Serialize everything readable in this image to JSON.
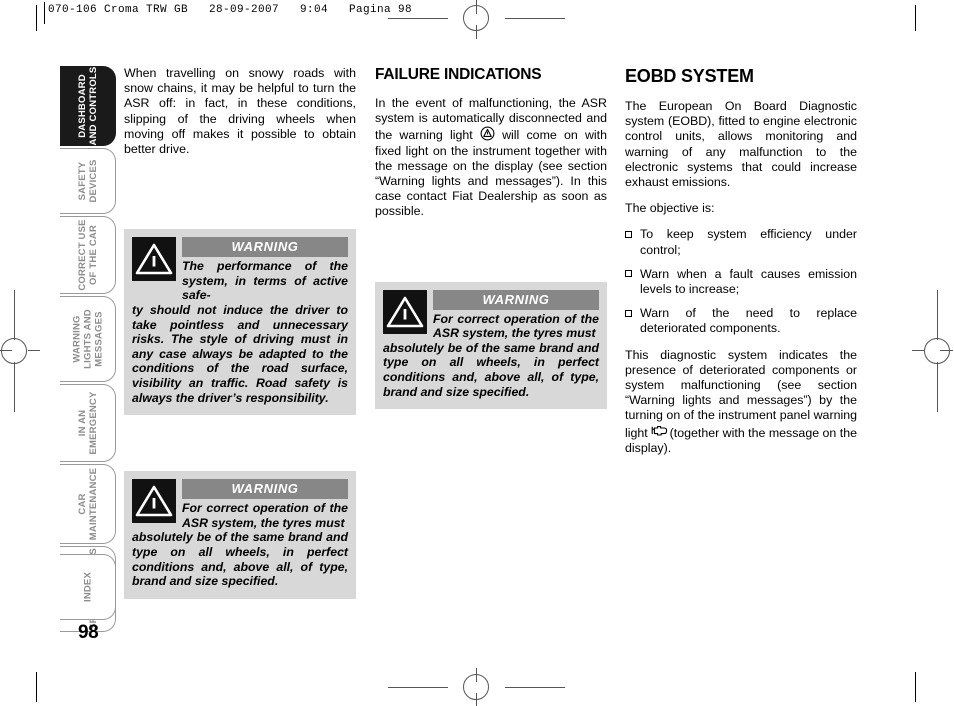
{
  "print_slug": "070-106 Croma TRW GB   28-09-2007   9:04   Pagina 98",
  "page_number": "98",
  "sidebar": {
    "tabs": [
      {
        "label": "DASHBOARD AND CONTROLS",
        "line1": "DASHBOARD",
        "line2": "AND CONTROLS",
        "active": true
      },
      {
        "label": "SAFETY DEVICES",
        "line1": "SAFETY",
        "line2": "DEVICES",
        "active": false
      },
      {
        "label": "CORRECT USE OF THE CAR",
        "line1": "CORRECT USE",
        "line2": "OF THE CAR",
        "active": false
      },
      {
        "label": "WARNING LIGHTS AND MESSAGES",
        "line1": "WARNING",
        "line2": "LIGHTS AND",
        "line3": "MESSAGES",
        "active": false
      },
      {
        "label": "IN AN EMERGENCY",
        "line1": "IN AN",
        "line2": "EMERGENCY",
        "active": false
      },
      {
        "label": "CAR MAINTENANCE",
        "line1": "CAR",
        "line2": "MAINTENANCE",
        "active": false
      },
      {
        "label": "TECHNICAL SPECIFICATIONS",
        "line1": "TECHNICAL",
        "line2": "SPECIFICATIONS",
        "active": false
      },
      {
        "label": "INDEX",
        "line1": "INDEX",
        "line2": "",
        "active": false
      }
    ]
  },
  "column_1": {
    "paragraph_1": "When travelling on snowy roads with snow chains, it may be helpful to turn the ASR off: in fact, in these conditions, slipping of the driving wheels when moving off makes it possible to obtain better drive.",
    "warning_1": {
      "title": "WARNING",
      "lead": "The performance of the system, in terms of active safe-",
      "rest": "ty should not induce the driver to take pointless and unnecessary risks. The style of driving must in any case always be adapted to the conditions of the road surface, visibility an traffic. Road safety is always the driver’s responsibility."
    },
    "warning_2": {
      "title": "WARNING",
      "lead": "For correct operation of the ASR system, the tyres must",
      "rest": "absolutely be of the same brand and type on all wheels, in perfect conditions and, above all, of type, brand and size specified."
    }
  },
  "column_2": {
    "heading": "FAILURE INDICATIONS",
    "paragraph_1_part_a": "In the event of malfunctioning, the ASR system is automatically disconnected and the warning light",
    "paragraph_1_part_b": "will come on with fixed light on the instrument together with the message on the display (see section “Warning lights and messages”). In this case contact Fiat Dealership as soon as possible.",
    "inline_icon": "asr-warning-light-icon",
    "warning_1": {
      "title": "WARNING",
      "lead": "For correct operation of the ASR system, the tyres must",
      "rest": "absolutely be of the same brand and type on all wheels, in perfect conditions and, above all, of type, brand and size specified."
    }
  },
  "column_3": {
    "heading": "EOBD SYSTEM",
    "paragraph_1": "The European On Board Diagnostic system (EOBD), fitted to engine electronic control units, allows monitoring and warning of any malfunction to the electronic systems that could increase exhaust emissions.",
    "paragraph_2": "The objective is:",
    "bullets": [
      "To keep system efficiency under control;",
      "Warn when a fault causes emission levels to increase;",
      "Warn of the need to replace deteriorated components."
    ],
    "paragraph_3_part_a": "This diagnostic system indicates the presence of deteriorated components or system malfunctioning (see section “Warning lights and messages”) by the turning on of the instrument panel warning light",
    "paragraph_3_part_b": "(together with the message on the display).",
    "inline_icon": "check-engine-eobd-icon"
  },
  "colors": {
    "active_tab_bg": "#1a1a1a",
    "inactive_tab_border": "#9a9a9a",
    "inactive_tab_text": "#8d8d8d",
    "warning_box_bg": "#d8d8d8",
    "warning_header_bg": "#878787",
    "warning_icon_bg": "#111111",
    "page_bg": "#ffffff",
    "text": "#000000"
  }
}
